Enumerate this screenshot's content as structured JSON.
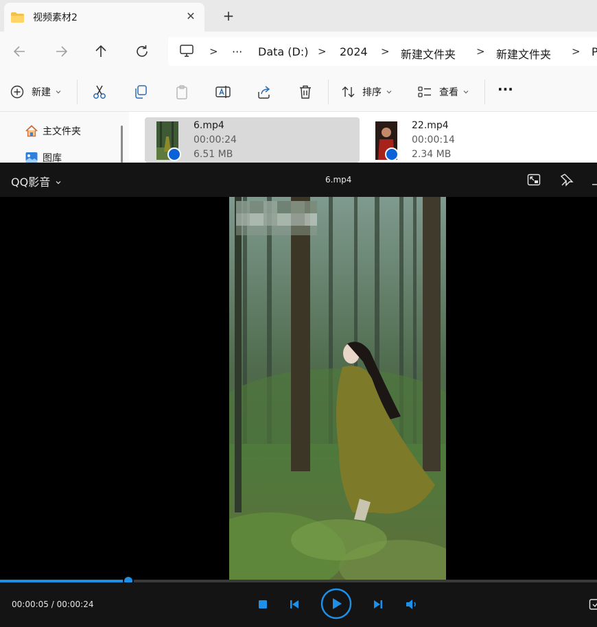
{
  "explorer": {
    "tab_title": "视频素材2",
    "breadcrumbs": [
      "Data (D:)",
      "2024",
      "新建文件夹",
      "新建文件夹",
      "P"
    ],
    "more_crumb": "···",
    "commands": {
      "new": "新建",
      "sort": "排序",
      "view": "查看",
      "more": "···"
    },
    "nav": [
      "主文件夹",
      "图库"
    ],
    "files": [
      {
        "name": "6.mp4",
        "duration": "00:00:24",
        "size": "6.51 MB"
      },
      {
        "name": "22.mp4",
        "duration": "00:00:14",
        "size": "2.34 MB"
      }
    ]
  },
  "player": {
    "brand": "QQ影音",
    "file_title": "6.mp4",
    "time_label": "00:00:05 / 00:00:24",
    "progress_fraction": 0.215,
    "accent": "#1e90e8"
  }
}
